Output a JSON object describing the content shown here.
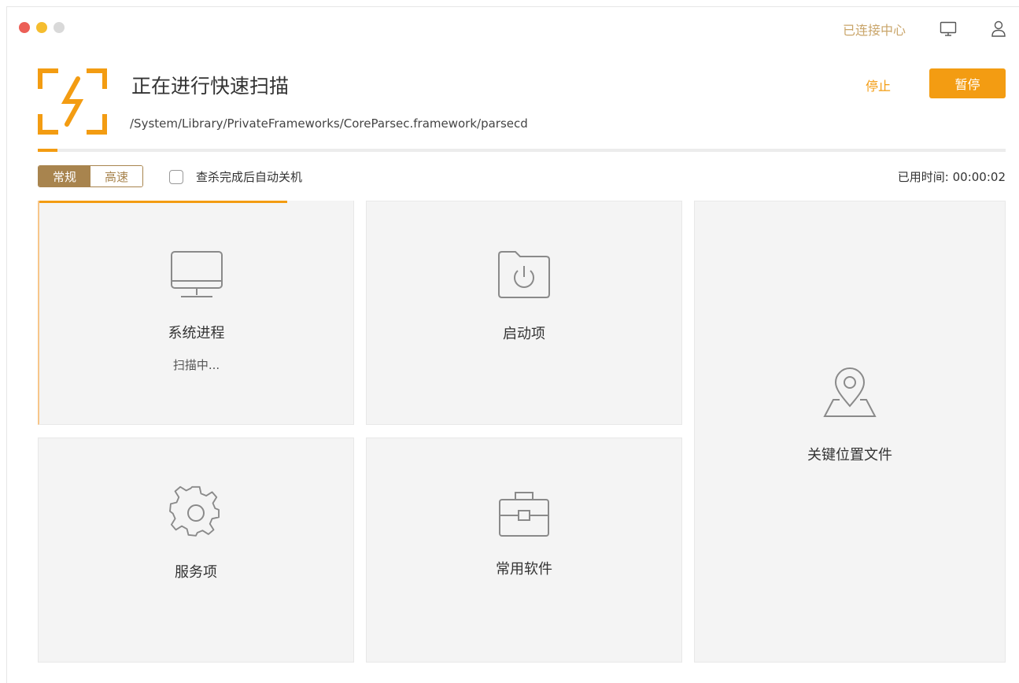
{
  "window": {
    "traffic_lights": [
      "close",
      "minimize",
      "zoom"
    ]
  },
  "topbar": {
    "center_link": "已连接中心",
    "icons": [
      "monitor-icon",
      "user-icon"
    ]
  },
  "scan": {
    "title": "正在进行快速扫描",
    "current_path": "/System/Library/PrivateFrameworks/CoreParsec.framework/parsecd",
    "stop_label": "停止",
    "pause_label": "暂停",
    "progress": 0.02,
    "accent_color": "#f39c12"
  },
  "options": {
    "mode_normal": "常规",
    "mode_fast": "高速",
    "active_mode": "常规",
    "auto_shutdown_label": "查杀完成后自动关机",
    "auto_shutdown_checked": false,
    "elapsed_label": "已用时间:",
    "elapsed_value": "00:00:02"
  },
  "cards": {
    "system_process": {
      "label": "系统进程",
      "status": "扫描中...",
      "icon": "monitor-icon",
      "progress": 0.79
    },
    "startup": {
      "label": "启动项",
      "icon": "startup-folder-icon"
    },
    "key_location": {
      "label": "关键位置文件",
      "icon": "location-map-icon"
    },
    "service": {
      "label": "服务项",
      "icon": "gear-icon"
    },
    "software": {
      "label": "常用软件",
      "icon": "briefcase-icon"
    }
  }
}
